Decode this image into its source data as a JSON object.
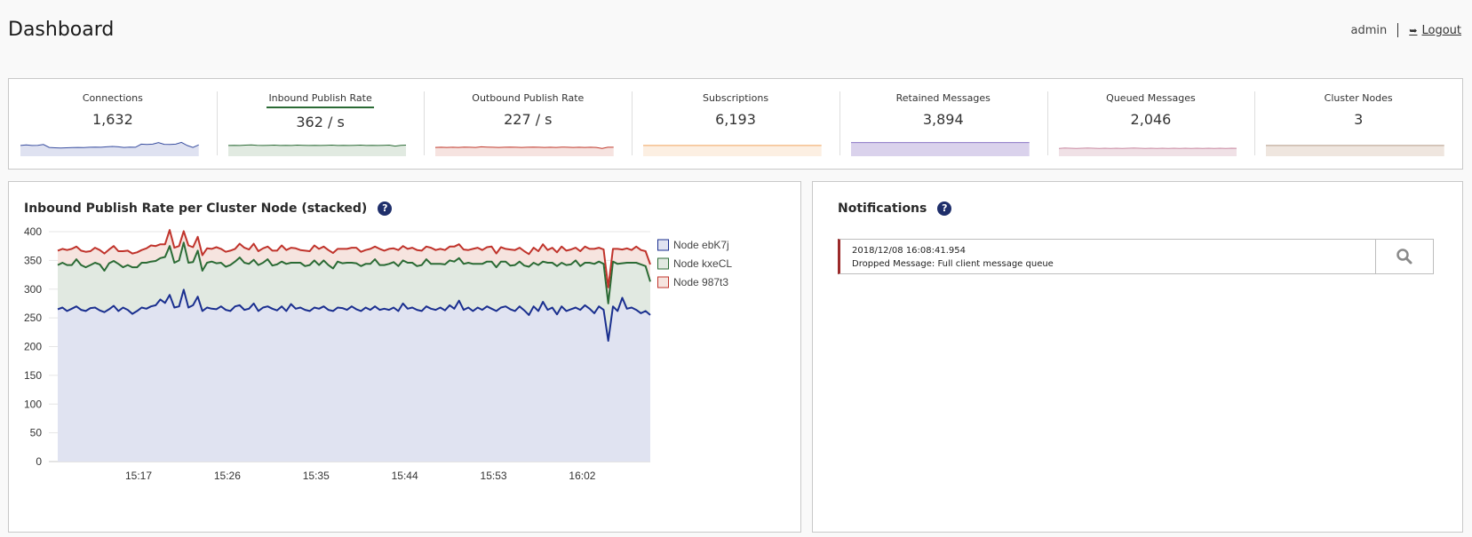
{
  "header": {
    "title": "Dashboard",
    "user": "admin",
    "logout_label": "Logout",
    "logout_icon": "sign-out-icon"
  },
  "stats": [
    {
      "label": "Connections",
      "value": "1,632",
      "color": "#3a4fa0",
      "fill": "#dfe2f1",
      "active": false,
      "spark": [
        0.55,
        0.58,
        0.55,
        0.56,
        0.6,
        0.45,
        0.43,
        0.42,
        0.43,
        0.44,
        0.45,
        0.44,
        0.46,
        0.47,
        0.46,
        0.48,
        0.5,
        0.48,
        0.45,
        0.47,
        0.46,
        0.62,
        0.6,
        0.62,
        0.7,
        0.61,
        0.6,
        0.62,
        0.71,
        0.55,
        0.45,
        0.58
      ]
    },
    {
      "label": "Inbound Publish Rate",
      "value": "362 / s",
      "color": "#2b6b35",
      "fill": "#e1eae1",
      "active": true,
      "spark": [
        0.55,
        0.56,
        0.55,
        0.57,
        0.58,
        0.56,
        0.55,
        0.56,
        0.57,
        0.55,
        0.56,
        0.55,
        0.57,
        0.56,
        0.55,
        0.56,
        0.55,
        0.56,
        0.57,
        0.55,
        0.56,
        0.55,
        0.56,
        0.57,
        0.55,
        0.56,
        0.55,
        0.56,
        0.57,
        0.52,
        0.56,
        0.57
      ]
    },
    {
      "label": "Outbound Publish Rate",
      "value": "227 / s",
      "color": "#c0392b",
      "fill": "#f6e3e0",
      "active": false,
      "spark": [
        0.45,
        0.46,
        0.45,
        0.46,
        0.45,
        0.47,
        0.46,
        0.45,
        0.48,
        0.47,
        0.46,
        0.45,
        0.46,
        0.47,
        0.46,
        0.45,
        0.46,
        0.47,
        0.46,
        0.45,
        0.46,
        0.45,
        0.47,
        0.46,
        0.45,
        0.46,
        0.45,
        0.46,
        0.45,
        0.4,
        0.46,
        0.46
      ]
    },
    {
      "label": "Subscriptions",
      "value": "6,193",
      "color": "#f0a35c",
      "fill": "#fcefe2",
      "active": false,
      "spark": [
        0.55,
        0.55,
        0.55,
        0.55,
        0.55,
        0.55,
        0.55,
        0.55,
        0.55,
        0.55,
        0.55,
        0.55,
        0.55,
        0.55,
        0.55,
        0.55,
        0.55,
        0.55,
        0.55,
        0.55,
        0.55,
        0.55,
        0.55,
        0.55,
        0.55,
        0.55,
        0.55,
        0.55,
        0.55,
        0.55,
        0.55,
        0.55
      ]
    },
    {
      "label": "Retained Messages",
      "value": "3,894",
      "color": "#8a76c4",
      "fill": "#dad2ec",
      "active": false,
      "spark": [
        0.7,
        0.7,
        0.7,
        0.7,
        0.7,
        0.7,
        0.7,
        0.7,
        0.7,
        0.7,
        0.7,
        0.7,
        0.7,
        0.7,
        0.7,
        0.7,
        0.7,
        0.7,
        0.7,
        0.7,
        0.7,
        0.7,
        0.7,
        0.7,
        0.7,
        0.7,
        0.7,
        0.7,
        0.7,
        0.7,
        0.7,
        0.7
      ]
    },
    {
      "label": "Queued Messages",
      "value": "2,046",
      "color": "#c98aa2",
      "fill": "#f0e1e6",
      "active": false,
      "spark": [
        0.4,
        0.42,
        0.41,
        0.4,
        0.41,
        0.42,
        0.41,
        0.4,
        0.41,
        0.4,
        0.41,
        0.4,
        0.41,
        0.42,
        0.41,
        0.4,
        0.41,
        0.4,
        0.41,
        0.4,
        0.41,
        0.4,
        0.41,
        0.4,
        0.41,
        0.4,
        0.41,
        0.4,
        0.41,
        0.4,
        0.41,
        0.4
      ]
    },
    {
      "label": "Cluster Nodes",
      "value": "3",
      "color": "#b39a86",
      "fill": "#efe6df",
      "active": false,
      "spark": [
        0.55,
        0.55,
        0.55,
        0.55,
        0.55,
        0.55,
        0.55,
        0.55,
        0.55,
        0.55,
        0.55,
        0.55,
        0.55,
        0.55,
        0.55,
        0.55,
        0.55,
        0.55,
        0.55,
        0.55,
        0.55,
        0.55,
        0.55,
        0.55,
        0.55,
        0.55,
        0.55,
        0.55,
        0.55,
        0.55,
        0.55,
        0.55
      ]
    }
  ],
  "chart_panel": {
    "title": "Inbound Publish Rate per Cluster Node (stacked)",
    "help_icon": "question-circle-icon"
  },
  "notifications": {
    "title": "Notifications",
    "help_icon": "question-circle-icon",
    "items": [
      {
        "timestamp": "2018/12/08 16:08:41.954",
        "message": "Dropped Message: Full client message queue",
        "severity_color": "#9b2a2a",
        "action_icon": "search-icon"
      }
    ]
  },
  "chart_data": {
    "type": "area",
    "stacked": true,
    "title": "Inbound Publish Rate per Cluster Node (stacked)",
    "xlabel": "",
    "ylabel": "",
    "ylim": [
      0,
      400
    ],
    "yticks": [
      0,
      50,
      100,
      150,
      200,
      250,
      300,
      350,
      400
    ],
    "xlim": [
      "15:08:48",
      "16:08:54"
    ],
    "xticks": [
      "15:17",
      "15:26",
      "15:35",
      "15:44",
      "15:53",
      "16:02"
    ],
    "grid": "horizontal",
    "legend_position": "right",
    "sample_interval_seconds": 30,
    "series": [
      {
        "name": "Node ebK7j",
        "color": "#1a2f8f",
        "fill": "#e0e3f1",
        "values": [
          265,
          268,
          262,
          266,
          270,
          264,
          262,
          267,
          268,
          263,
          260,
          265,
          271,
          262,
          268,
          264,
          257,
          262,
          268,
          266,
          270,
          272,
          282,
          276,
          290,
          268,
          270,
          299,
          268,
          272,
          287,
          262,
          268,
          266,
          265,
          270,
          264,
          262,
          270,
          272,
          264,
          266,
          275,
          262,
          268,
          270,
          266,
          263,
          270,
          262,
          274,
          266,
          268,
          264,
          262,
          268,
          266,
          270,
          264,
          262,
          268,
          267,
          264,
          270,
          265,
          262,
          268,
          264,
          270,
          264,
          266,
          264,
          268,
          262,
          275,
          266,
          268,
          264,
          262,
          270,
          266,
          264,
          268,
          263,
          272,
          266,
          280,
          264,
          268,
          262,
          268,
          264,
          270,
          266,
          262,
          268,
          270,
          265,
          262,
          270,
          263,
          255,
          270,
          262,
          278,
          264,
          268,
          256,
          270,
          262,
          265,
          268,
          264,
          272,
          266,
          258,
          270,
          264,
          210,
          270,
          262,
          285,
          266,
          268,
          264,
          258,
          262,
          255
        ]
      },
      {
        "name": "Node kxeCL",
        "color": "#2b6b35",
        "fill": "#e1e9e1",
        "values": [
          77,
          78,
          80,
          76,
          82,
          78,
          76,
          75,
          78,
          80,
          72,
          80,
          78,
          82,
          70,
          78,
          81,
          76,
          78,
          80,
          78,
          77,
          72,
          80,
          85,
          78,
          80,
          82,
          78,
          75,
          80,
          70,
          78,
          82,
          80,
          76,
          75,
          80,
          78,
          83,
          82,
          78,
          76,
          80,
          78,
          82,
          75,
          80,
          78,
          82,
          72,
          80,
          78,
          76,
          80,
          82,
          76,
          80,
          78,
          74,
          80,
          78,
          82,
          76,
          80,
          78,
          76,
          80,
          82,
          78,
          76,
          80,
          79,
          78,
          75,
          80,
          78,
          76,
          80,
          82,
          78,
          80,
          76,
          80,
          78,
          82,
          74,
          80,
          78,
          82,
          76,
          80,
          78,
          82,
          76,
          80,
          78,
          76,
          80,
          78,
          78,
          84,
          76,
          80,
          70,
          82,
          78,
          84,
          76,
          80,
          78,
          82,
          76,
          74,
          80,
          86,
          78,
          80,
          65,
          78,
          82,
          60,
          80,
          78,
          82,
          85,
          78,
          58
        ]
      },
      {
        "name": "Node 987t3",
        "color": "#c0332b",
        "fill": "#f6e4df",
        "values": [
          25,
          24,
          26,
          28,
          22,
          25,
          27,
          24,
          26,
          25,
          30,
          24,
          26,
          22,
          28,
          25,
          24,
          26,
          22,
          25,
          28,
          26,
          24,
          22,
          28,
          26,
          25,
          20,
          30,
          26,
          24,
          27,
          25,
          22,
          28,
          24,
          26,
          25,
          22,
          24,
          26,
          25,
          28,
          24,
          25,
          22,
          26,
          24,
          28,
          24,
          26,
          25,
          22,
          27,
          24,
          26,
          28,
          24,
          26,
          27,
          22,
          25,
          24,
          26,
          27,
          25,
          24,
          26,
          22,
          28,
          25,
          26,
          24,
          28,
          25,
          24,
          26,
          28,
          25,
          22,
          28,
          24,
          26,
          25,
          24,
          26,
          24,
          25,
          22,
          26,
          28,
          24,
          25,
          26,
          24,
          25,
          22,
          28,
          26,
          24,
          25,
          22,
          26,
          24,
          30,
          22,
          26,
          24,
          28,
          25,
          26,
          22,
          26,
          28,
          24,
          26,
          24,
          25,
          28,
          22,
          26,
          24,
          25,
          22,
          28,
          25,
          26,
          30
        ]
      }
    ]
  }
}
